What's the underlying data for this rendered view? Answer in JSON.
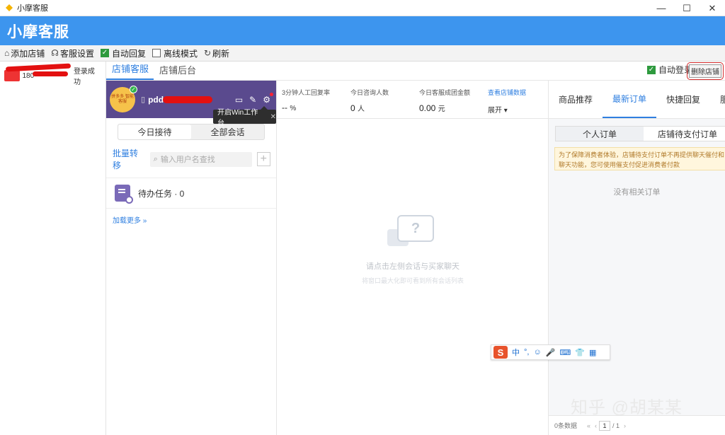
{
  "window": {
    "title": "小摩客服",
    "minimize": "—",
    "maximize": "☐",
    "close": "✕"
  },
  "brand": "小摩客服",
  "toolbar": {
    "add_store": "添加店铺",
    "cs_settings": "客服设置",
    "auto_reply": "自动回复",
    "auto_reply_checked": true,
    "offline_mode": "离线模式",
    "offline_mode_checked": false,
    "refresh": "刷新"
  },
  "stores": [
    {
      "id": "180",
      "status": "登录成功"
    }
  ],
  "tabs": [
    {
      "label": "店铺客服",
      "active": true
    },
    {
      "label": "店铺后台",
      "active": false
    }
  ],
  "auto_login": {
    "label": "自动登录",
    "checked": true
  },
  "delete_store": "删除店铺",
  "conversation": {
    "shop_logo_text": "拼多多 智能客服",
    "shop_name": "pdd",
    "tooltip": "开启Win工作台",
    "tooltip_close": "✕",
    "segments": [
      "今日接待",
      "全部会话"
    ],
    "batch_transfer": "批量转移",
    "search_placeholder": "输入用户名查找",
    "todo": "待办任务 · 0",
    "load_more": "加载更多 »"
  },
  "stats": [
    {
      "label": "3分钟人工回复率",
      "value": "--",
      "unit": "%"
    },
    {
      "label": "今日咨询人数",
      "value": "0",
      "unit": "人"
    },
    {
      "label": "今日客服成团金额",
      "value": "0.00",
      "unit": "元"
    }
  ],
  "stats_link": {
    "label": "查看店铺数据",
    "action": "展开 ▾"
  },
  "empty_state": {
    "icon_glyph": "?",
    "main": "请点击左侧会话与买家聊天",
    "sub": "将窗口最大化即可看到所有会话列表"
  },
  "right_tabs": [
    {
      "label": "商品推荐",
      "active": false
    },
    {
      "label": "最新订单",
      "active": true
    },
    {
      "label": "快捷回复",
      "active": false
    },
    {
      "label": "服务",
      "active": false
    }
  ],
  "order_segments": [
    "个人订单",
    "店铺待支付订单"
  ],
  "notice": "为了保障消费者体验，店铺待支付订单不再提供聊天催付和聊天功能，您可使用催支付促进消费者付款",
  "no_orders": "没有相关订单",
  "pager": {
    "count": "0条数据",
    "page": "1",
    "total": "/ 1"
  },
  "ime": {
    "lang": "中",
    "items": [
      "°,",
      "☺",
      "🎤",
      "⌨",
      "👕",
      "▦"
    ]
  },
  "watermark": "知乎 @胡某某",
  "colors": {
    "brand": "#3d95ee",
    "accent": "#2f7fe0",
    "shop_header": "#5a4a8e",
    "delete_highlight": "#d42a2a"
  }
}
